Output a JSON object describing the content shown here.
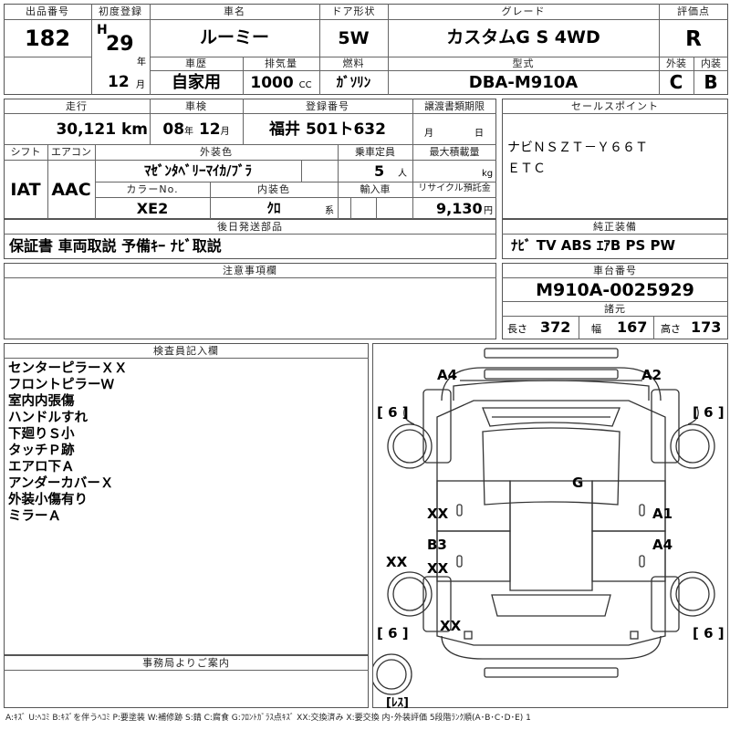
{
  "header": {
    "lot_no_label": "出品番号",
    "lot_no": "182",
    "first_reg_label": "初度登録",
    "era": "H",
    "year": "29",
    "year_unit": "年",
    "month": "12",
    "month_unit": "月",
    "car_name_label": "車名",
    "car_name": "ルーミー",
    "door_label": "ドア形状",
    "door": "5W",
    "grade_label": "グレード",
    "grade": "カスタムG S 4WD",
    "score_label": "評価点",
    "score": "R",
    "history_label": "車歴",
    "history": "自家用",
    "displacement_label": "排気量",
    "displacement": "1000",
    "displacement_unit": "CC",
    "fuel_label": "燃料",
    "fuel": "ｶﾞｿﾘﾝ",
    "model_label": "型式",
    "model": "DBA-M910A",
    "exterior_label": "外装",
    "exterior": "C",
    "interior_label": "内装",
    "interior": "B"
  },
  "row2": {
    "mileage_label": "走行",
    "mileage": "30,121",
    "mileage_unit": "km",
    "inspection_label": "車検",
    "insp_year": "08",
    "insp_year_unit": "年",
    "insp_month": "12",
    "insp_month_unit": "月",
    "plate_label": "登録番号",
    "plate": "福井 501ト632",
    "transfer_label": "譲渡書類期限",
    "transfer_month": "月",
    "transfer_day": "日",
    "shift_label": "シフト",
    "shift": "IAT",
    "ac_label": "エアコン",
    "ac": "AAC",
    "ext_color_label": "外装色",
    "ext_color": "ﾏｾﾞﾝﾀﾍﾞﾘｰﾏｲｶ/ﾌﾞﾗ",
    "capacity_label": "乗車定員",
    "capacity": "5",
    "capacity_unit": "人",
    "load_label": "最大積載量",
    "load_unit": "kg",
    "color_no_label": "カラーNo.",
    "color_no": "XE2",
    "int_color_label": "内装色",
    "int_color": "ｸﾛ",
    "int_color_unit": "系",
    "import_label": "輸入車",
    "recycle_label": "リサイクル預託金",
    "recycle": "9,130",
    "recycle_unit": "円"
  },
  "sales": {
    "label": "セールスポイント",
    "line1": "ナビＮＳＺＴ－Ｙ６６Ｔ",
    "line2": "ＥＴＣ"
  },
  "later_parts": {
    "label": "後日発送部品",
    "value": "保証書 車両取説 予備ｷｰ ﾅﾋﾞ取説"
  },
  "equipment": {
    "label": "純正装備",
    "value": "ﾅﾋﾞ  TV  ABS ｴｱB PS PW"
  },
  "notes": {
    "label": "注意事項欄"
  },
  "chassis": {
    "label": "車台番号",
    "value": "M910A-0025929"
  },
  "specs": {
    "label": "諸元",
    "length_label": "長さ",
    "length": "372",
    "width_label": "幅",
    "width": "167",
    "height_label": "高さ",
    "height": "173"
  },
  "inspector": {
    "label": "検査員記入欄",
    "lines": [
      "センターピラーＸＸ",
      "フロントピラーＷ",
      "室内内張傷",
      "ハンドルすれ",
      "下廻りＳ小",
      "タッチＰ跡",
      "エアロ下Ａ",
      "アンダーカバーＸ",
      "外装小傷有り",
      "ミラーＡ"
    ]
  },
  "office": {
    "label": "事務局よりご案内"
  },
  "diagram": {
    "marks": {
      "a4_front_left": "A4",
      "a2_front_right": "A2",
      "tire_fl": "[ 6 ]",
      "tire_fr": "[ 6 ]",
      "tire_rl": "[ 6 ]",
      "tire_rr": "[ 6 ]",
      "g_windshield": "G",
      "xx_left_front_door": "XX",
      "a1_right_front_door": "A1",
      "b3_left_pillar": "B3",
      "xx_left_rear_door": "XX",
      "a4_right_rear_door": "A4",
      "xx_left_side": "XX",
      "xx_rear": "XX",
      "res": "[ﾚｽ]"
    }
  },
  "legend": "A:ｷｽﾞ U:ﾍｺﾐ B:ｷｽﾞを伴うﾍｺﾐ P:要塗装 W:補修跡 S:錆 C:腐食 G:ﾌﾛﾝﾄｶﾞﾗｽ点ｷｽﾞ XX:交換済み X:要交換 内･外装評価 5段階ﾗﾝｸ順(A･B･C･D･E) 1",
  "colors": {
    "line": "#555555",
    "text": "#000000"
  }
}
